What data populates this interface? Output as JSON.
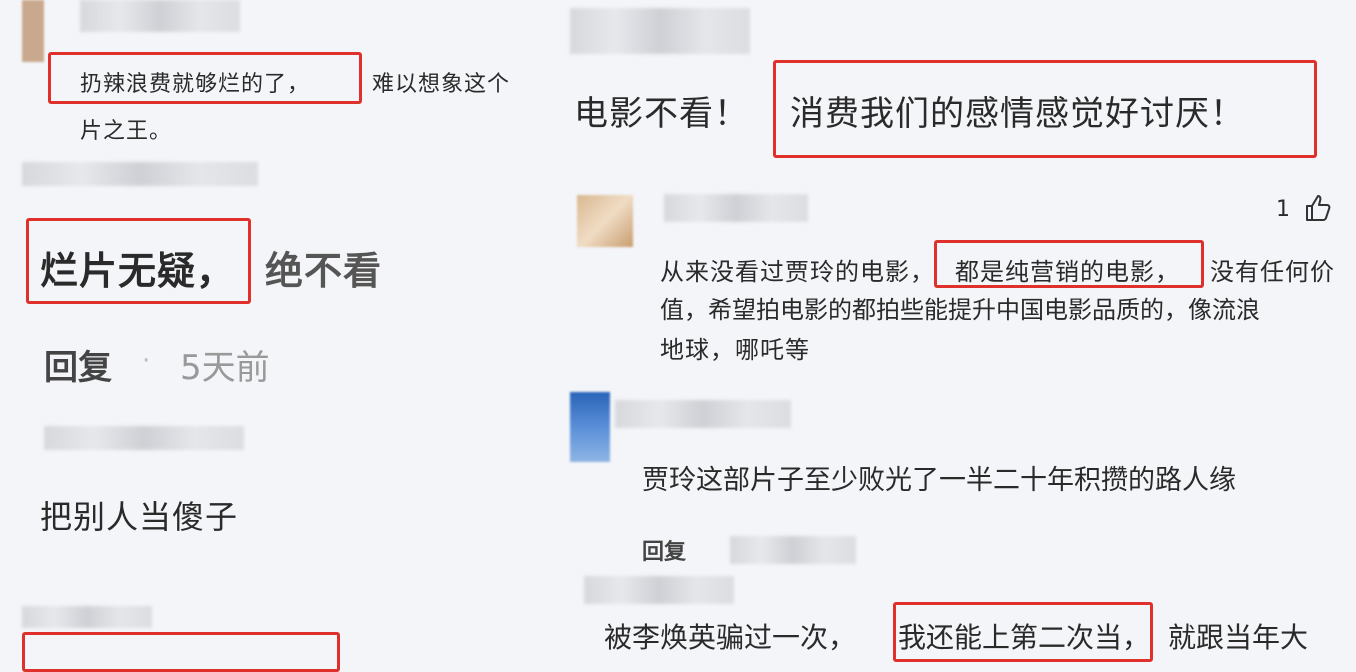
{
  "left": {
    "c1_line1": "扔辣浪费就够烂的了，",
    "c1_line1_cont": "难以想象这个",
    "c1_line2": "片之王。",
    "c2_text_boxed": "烂片无疑，",
    "c2_text_rest": "绝不看",
    "c2_reply": "回复",
    "c2_dot": "·",
    "c2_time": "5天前",
    "c3_text": "把别人当傻子",
    "c4_text": "被李焕英骗过一次，我还能上第二次当，就跟当年大"
  },
  "right": {
    "c1_prefix": "电影不看！",
    "c1_boxed": "消费我们的感情感觉好讨厌！",
    "c2_like_count": "1",
    "c2_line1_a": "从来没看过贾玲的电影，",
    "c2_line1_boxed": "都是纯营销的电影，",
    "c2_line1_b": "没有任何价",
    "c2_line2": "值，希望拍电影的都拍些能提升中国电影品质的，像流浪",
    "c2_line3": "地球，哪吒等",
    "c3_text": "贾玲这部片子至少败光了一半二十年积攒的路人缘",
    "c3_reply": "回复",
    "c4_a": "被李焕英骗过一次，",
    "c4_boxed": "我还能上第二次当，",
    "c4_b": "就跟当年大"
  },
  "colors": {
    "highlight": "#e0302b"
  }
}
